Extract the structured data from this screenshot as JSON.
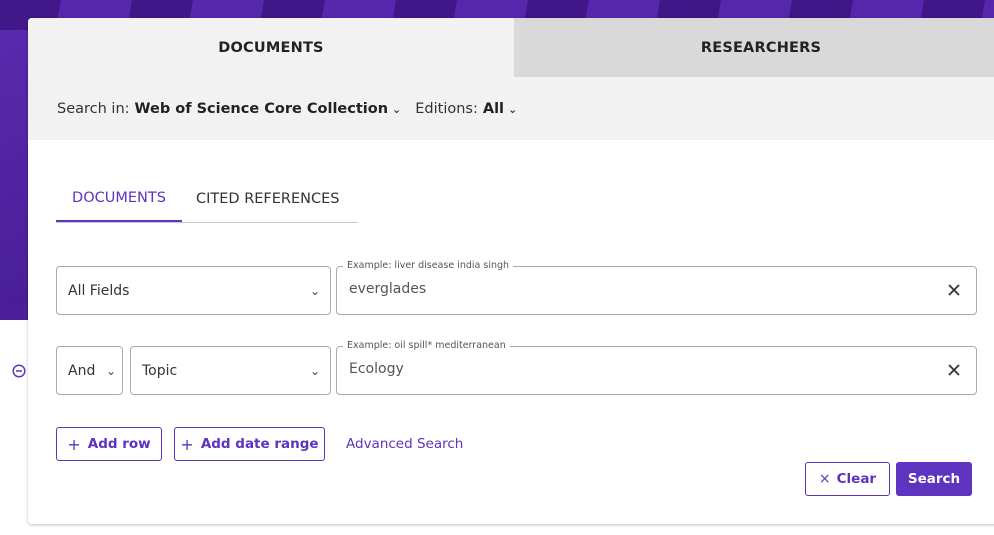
{
  "top_tabs": {
    "documents": "DOCUMENTS",
    "researchers": "RESEARCHERS"
  },
  "scope": {
    "search_in_label": "Search in:",
    "collection": "Web of Science Core Collection",
    "editions_label": "Editions:",
    "editions_value": "All"
  },
  "sub_tabs": {
    "documents": "DOCUMENTS",
    "cited_references": "CITED REFERENCES"
  },
  "rows": [
    {
      "field": "All Fields",
      "placeholder_example": "Example: liver disease india singh",
      "value": "everglades"
    },
    {
      "operator": "And",
      "field": "Topic",
      "placeholder_example": "Example: oil spill* mediterranean",
      "value": "Ecology"
    }
  ],
  "actions": {
    "add_row": "Add row",
    "add_date_range": "Add date range",
    "advanced_search": "Advanced Search",
    "clear": "Clear",
    "search": "Search"
  },
  "icons": {
    "chevron": "chevron-down-icon",
    "clear": "close-icon",
    "remove_row": "minus-circle-icon",
    "plus": "plus-icon"
  },
  "colors": {
    "accent": "#5e33bf",
    "header_bg": "#4b1e99",
    "tab_active_bg": "#f2f2f2",
    "tab_inactive_bg": "#d9d9d9"
  }
}
